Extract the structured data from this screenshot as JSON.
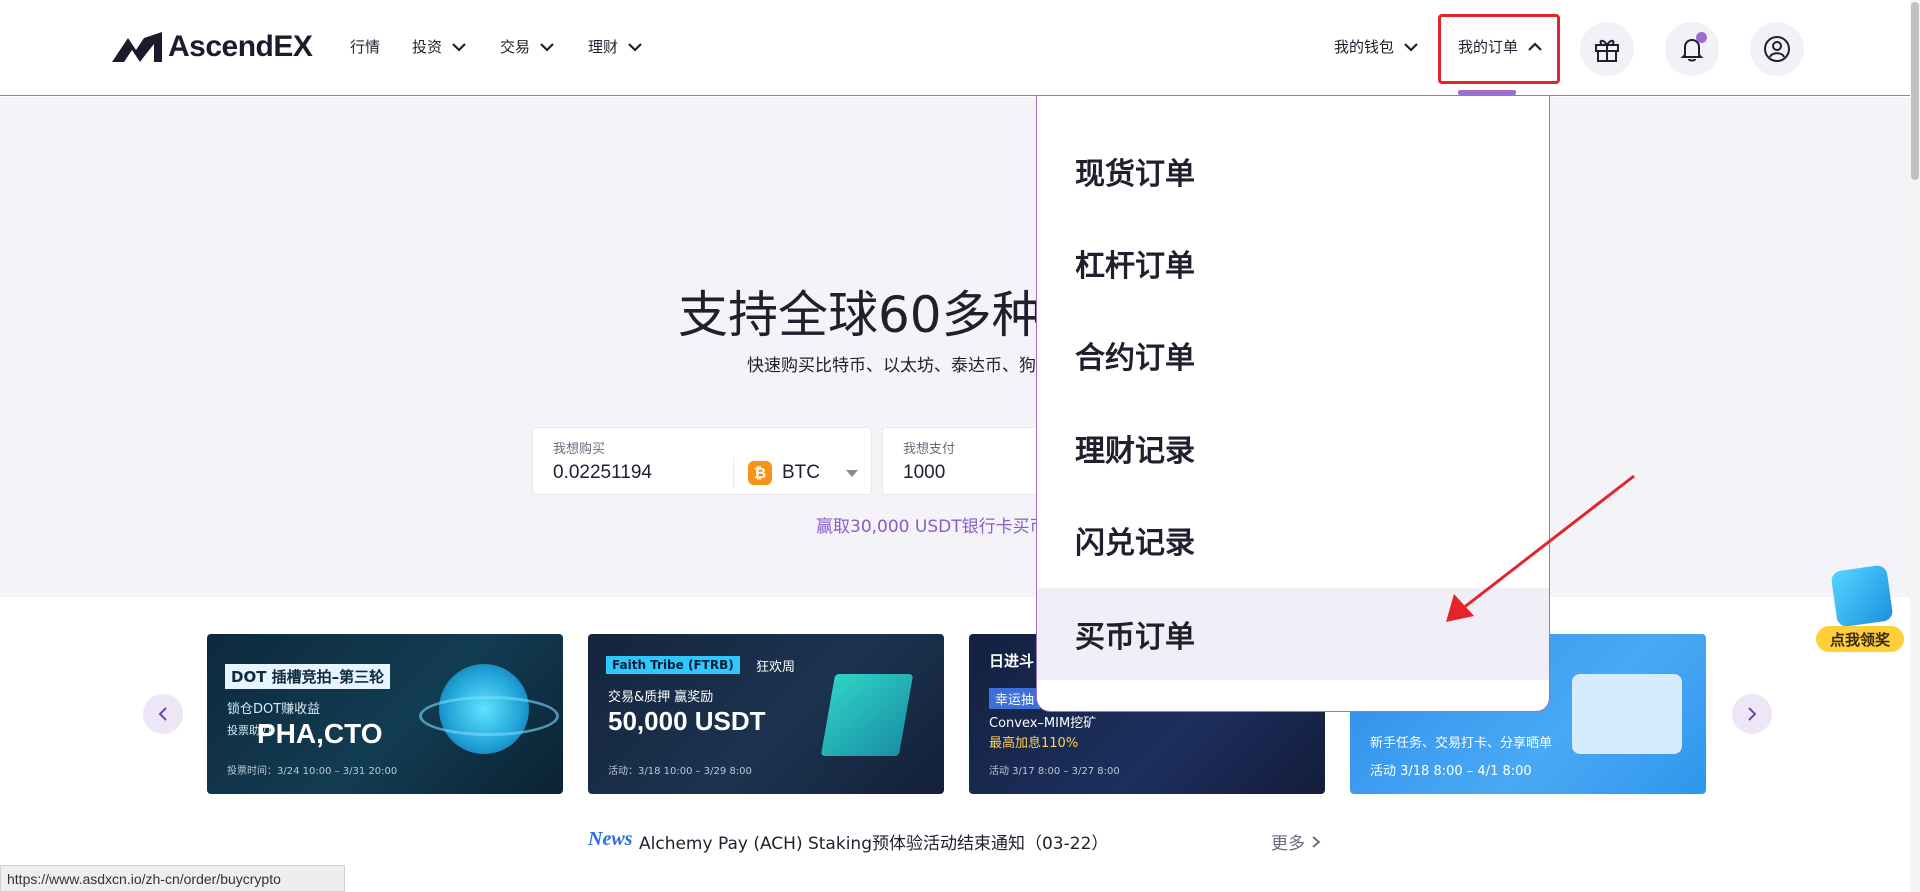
{
  "header": {
    "logo_text": "AscendEX",
    "nav": [
      {
        "label": "行情",
        "has_dropdown": false
      },
      {
        "label": "投资",
        "has_dropdown": true
      },
      {
        "label": "交易",
        "has_dropdown": true
      },
      {
        "label": "理财",
        "has_dropdown": true
      }
    ],
    "wallet_label": "我的钱包",
    "orders_label": "我的订单"
  },
  "hero": {
    "title": "支持全球60多种",
    "subtitle": "快速购买比特币、以太坊、泰达币、狗",
    "buy": {
      "label": "我想购买",
      "value": "0.02251194",
      "coin": "BTC",
      "coin_symbol": "₿"
    },
    "pay": {
      "label": "我想支付",
      "value": "1000"
    },
    "promo": "赢取30,000 USDT银行卡买币"
  },
  "banners": [
    {
      "tag": "DOT 插槽竞拍–第三轮",
      "line1": "锁仓DOT赚收益",
      "line2": "投票助力",
      "big": "PHA,CTO",
      "small": "投票时间：3/24 10:00 – 3/31 20:00"
    },
    {
      "tag": "Faith Tribe (FTRB)",
      "tag2": "狂欢周",
      "line1": "交易&质押 赢奖励",
      "big": "50,000 USDT",
      "small": "活动：3/18 10:00 – 3/29 8:00"
    },
    {
      "tag": "日进斗",
      "line1": "幸运抽",
      "line2": "Convex–MIM挖矿",
      "line3": "最高加息110%",
      "small": "活动 3/17 8:00 – 3/27 8:00"
    },
    {
      "line1": "新手任务、交易打卡、分享晒单",
      "small": "活动 3/18 8:00 – 4/1 8:00"
    }
  ],
  "news": {
    "logo": "News",
    "text": "Alchemy Pay (ACH) Staking预体验活动结束通知（03-22）",
    "more": "更多"
  },
  "status_url": "https://www.asdxcn.io/zh-cn/order/buycrypto",
  "dropdown": {
    "items": [
      {
        "label": "现货订单"
      },
      {
        "label": "杠杆订单"
      },
      {
        "label": "合约订单"
      },
      {
        "label": "理财记录"
      },
      {
        "label": "闪兑记录"
      },
      {
        "label": "买币订单"
      }
    ],
    "active_index": 5
  },
  "gift_float_label": "点我领奖",
  "colors": {
    "accent": "#9b6fd0",
    "highlight_box": "#e5232a",
    "arrow": "#e5232a"
  }
}
